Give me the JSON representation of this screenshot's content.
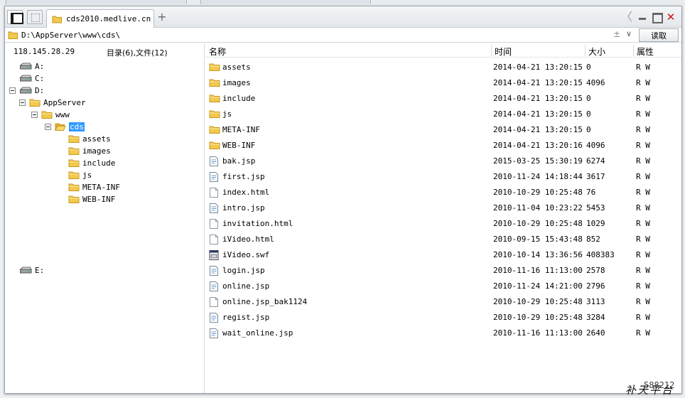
{
  "tab": {
    "title": "cds2010.medlive.cn",
    "add_label": "+"
  },
  "window_controls": {
    "back": "〈",
    "close": "✕"
  },
  "address": {
    "path": "D:\\AppServer\\www\\cds\\",
    "pm": "±",
    "dropdown": "∨",
    "read_label": "读取"
  },
  "left_pane": {
    "ip": "118.145.28.29",
    "summary": "目录(6),文件(12)",
    "tree": [
      {
        "label": "A:",
        "kind": "drive",
        "level": 0,
        "expander": false
      },
      {
        "label": "C:",
        "kind": "drive",
        "level": 0,
        "expander": false
      },
      {
        "label": "D:",
        "kind": "drive",
        "level": 0,
        "expander": true
      },
      {
        "label": "AppServer",
        "kind": "folder",
        "level": 1,
        "expander": true
      },
      {
        "label": "www",
        "kind": "folder",
        "level": 2,
        "expander": true
      },
      {
        "label": "cds",
        "kind": "folder-open",
        "level": 3,
        "expander": true,
        "selected": true
      },
      {
        "label": "assets",
        "kind": "folder",
        "level": 4,
        "expander": false
      },
      {
        "label": "images",
        "kind": "folder",
        "level": 4,
        "expander": false
      },
      {
        "label": "include",
        "kind": "folder",
        "level": 4,
        "expander": false
      },
      {
        "label": "js",
        "kind": "folder",
        "level": 4,
        "expander": false
      },
      {
        "label": "META-INF",
        "kind": "folder",
        "level": 4,
        "expander": false
      },
      {
        "label": "WEB-INF",
        "kind": "folder",
        "level": 4,
        "expander": false
      },
      {
        "label": "E:",
        "kind": "drive",
        "level": 0,
        "expander": false,
        "gap": true
      }
    ]
  },
  "file_list": {
    "columns": {
      "name": "名称",
      "time": "时间",
      "size": "大小",
      "attr": "属性"
    },
    "rows": [
      {
        "name": "assets",
        "time": "2014-04-21 13:20:15",
        "size": "0",
        "attr": "R W",
        "icon": "folder"
      },
      {
        "name": "images",
        "time": "2014-04-21 13:20:15",
        "size": "4096",
        "attr": "R W",
        "icon": "folder"
      },
      {
        "name": "include",
        "time": "2014-04-21 13:20:15",
        "size": "0",
        "attr": "R W",
        "icon": "folder"
      },
      {
        "name": "js",
        "time": "2014-04-21 13:20:15",
        "size": "0",
        "attr": "R W",
        "icon": "folder"
      },
      {
        "name": "META-INF",
        "time": "2014-04-21 13:20:15",
        "size": "0",
        "attr": "R W",
        "icon": "folder"
      },
      {
        "name": "WEB-INF",
        "time": "2014-04-21 13:20:16",
        "size": "4096",
        "attr": "R W",
        "icon": "folder"
      },
      {
        "name": "bak.jsp",
        "time": "2015-03-25 15:30:19",
        "size": "6274",
        "attr": "R W",
        "icon": "file-text"
      },
      {
        "name": "first.jsp",
        "time": "2010-11-24 14:18:44",
        "size": "3617",
        "attr": "R W",
        "icon": "file-text"
      },
      {
        "name": "index.html",
        "time": "2010-10-29 10:25:48",
        "size": "76",
        "attr": "R W",
        "icon": "file-blank"
      },
      {
        "name": "intro.jsp",
        "time": "2010-11-04 10:23:22",
        "size": "5453",
        "attr": "R W",
        "icon": "file-text"
      },
      {
        "name": "invitation.html",
        "time": "2010-10-29 10:25:48",
        "size": "1029",
        "attr": "R W",
        "icon": "file-blank"
      },
      {
        "name": "iVideo.html",
        "time": "2010-09-15 15:43:48",
        "size": "852",
        "attr": "R W",
        "icon": "file-blank"
      },
      {
        "name": "iVideo.swf",
        "time": "2010-10-14 13:36:56",
        "size": "408383",
        "attr": "R W",
        "icon": "file-app"
      },
      {
        "name": "login.jsp",
        "time": "2010-11-16 11:13:00",
        "size": "2578",
        "attr": "R W",
        "icon": "file-text"
      },
      {
        "name": "online.jsp",
        "time": "2010-11-24 14:21:00",
        "size": "2796",
        "attr": "R W",
        "icon": "file-text"
      },
      {
        "name": "online.jsp_bak1124",
        "time": "2010-10-29 10:25:48",
        "size": "3113",
        "attr": "R W",
        "icon": "file-blank"
      },
      {
        "name": "regist.jsp",
        "time": "2010-10-29 10:25:48",
        "size": "3284",
        "attr": "R W",
        "icon": "file-text"
      },
      {
        "name": "wait_online.jsp",
        "time": "2010-11-16 11:13:00",
        "size": "2640",
        "attr": "R W",
        "icon": "file-text"
      }
    ]
  },
  "watermark": {
    "id": "588212",
    "brand": "补天平台"
  },
  "colors": {
    "folder": "#f2c94c",
    "folder_edge": "#c8961e",
    "selection": "#3399ff",
    "close": "#d01010"
  }
}
